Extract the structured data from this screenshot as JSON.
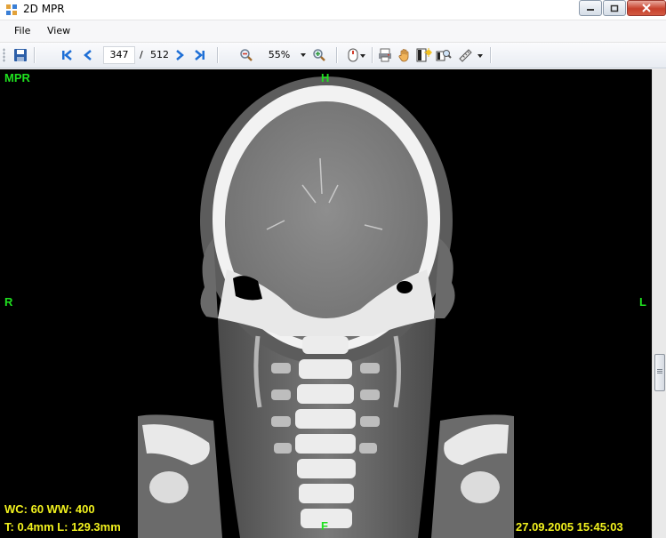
{
  "window": {
    "title": "2D MPR"
  },
  "menu": {
    "file": "File",
    "view": "View"
  },
  "toolbar": {
    "slice_current": "347",
    "slice_separator": "/",
    "slice_total": "512",
    "zoom_value": "55%"
  },
  "overlay": {
    "view_name": "MPR",
    "orient_top": "H",
    "orient_bottom": "F",
    "orient_left": "R",
    "orient_right": "L",
    "window_info": "WC: 60 WW: 400",
    "slice_info": "T: 0.4mm L: 129.3mm",
    "datetime": "27.09.2005 15:45:03"
  },
  "colors": {
    "overlay_green": "#1fe01f",
    "overlay_yellow": "#f2f21e",
    "nav_blue": "#1e6fd6",
    "close_red": "#c7402c"
  },
  "icons": [
    "save-icon",
    "first-slice-icon",
    "prev-slice-icon",
    "next-slice-icon",
    "last-slice-icon",
    "zoom-out-icon",
    "dropdown-icon",
    "zoom-in-icon",
    "mouse-mode-icon",
    "print-icon",
    "pan-hand-icon",
    "window-level-icon",
    "magnifier-icon",
    "measure-ruler-icon"
  ]
}
